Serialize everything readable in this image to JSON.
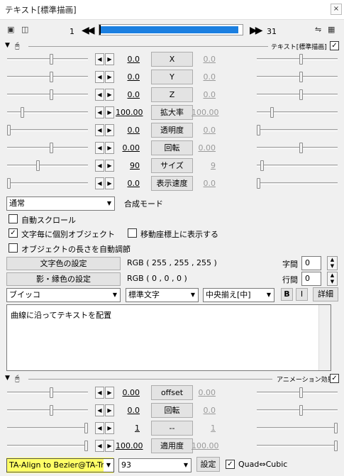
{
  "window": {
    "title": "テキスト[標準描画]",
    "close": "×"
  },
  "toolbar": {
    "frame_start": "1",
    "frame_end": "31",
    "prev": "◀◀",
    "next": "▶▶",
    "progress_fraction": 0.97
  },
  "text_section": {
    "label": "テキスト[標準描画]",
    "enabled_mark": "✓"
  },
  "params": [
    {
      "name": "X",
      "left": "0.0",
      "right": "0.0",
      "lpos": 0.55,
      "rpos": 0.55
    },
    {
      "name": "Y",
      "left": "0.0",
      "right": "0.0",
      "lpos": 0.55,
      "rpos": 0.55
    },
    {
      "name": "Z",
      "left": "0.0",
      "right": "0.0",
      "lpos": 0.55,
      "rpos": 0.55
    },
    {
      "name": "拡大率",
      "left": "100.00",
      "right": "100.00",
      "lpos": 0.17,
      "rpos": 0.17
    },
    {
      "name": "透明度",
      "left": "0.0",
      "right": "0.0",
      "lpos": 0.0,
      "rpos": 0.0
    },
    {
      "name": "回転",
      "left": "0.00",
      "right": "0.00",
      "lpos": 0.55,
      "rpos": 0.55
    },
    {
      "name": "サイズ",
      "left": "90",
      "right": "9",
      "lpos": 0.38,
      "rpos": 0.05
    },
    {
      "name": "表示速度",
      "left": "0.0",
      "right": "0.0",
      "lpos": 0.0,
      "rpos": 0.0
    }
  ],
  "blend": {
    "value": "通常",
    "label": "合成モード"
  },
  "options": {
    "auto_scroll": "自動スクロール",
    "per_char": "文字毎に個別オブジェクト",
    "per_char_checked": true,
    "show_on_move": "移動座標上に表示する",
    "auto_length": "オブジェクトの長さを自動調節"
  },
  "color": {
    "text_color_btn": "文字色の設定",
    "text_rgb": "RGB ( 255 , 255 , 255 )",
    "shadow_btn": "影・縁色の設定",
    "shadow_rgb": "RGB ( 0 , 0 , 0 )",
    "char_spacing_label": "字間",
    "char_spacing": "0",
    "line_spacing_label": "行間",
    "line_spacing": "0"
  },
  "font": {
    "name": "ブイッコ",
    "style": "標準文字",
    "align": "中央揃え[中]",
    "bold": "B",
    "italic": "I",
    "detail": "詳細"
  },
  "text_body": "曲線に沿ってテキストを配置",
  "anim_section": {
    "label": "アニメーション効果",
    "enabled_mark": "✓"
  },
  "anim_params": [
    {
      "name": "offset",
      "left": "0.00",
      "right": "0.00",
      "lpos": 0.55,
      "rpos": 0.55
    },
    {
      "name": "回転",
      "left": "0.0",
      "right": "0.0",
      "lpos": 0.55,
      "rpos": 0.55
    },
    {
      "name": "--",
      "left": "1",
      "right": "1",
      "lpos": 1.0,
      "rpos": 1.0
    },
    {
      "name": "適用度",
      "left": "100.00",
      "right": "100.00",
      "lpos": 1.0,
      "rpos": 1.0
    }
  ],
  "footer": {
    "script": "TA-Align to Bezier@TA-Tr",
    "value": "93",
    "setting": "設定",
    "quad": "Quad⇔Cubic",
    "quad_checked": true
  },
  "colors": {
    "highlight": "#ffff66",
    "timeline": "#1b7fe0"
  }
}
